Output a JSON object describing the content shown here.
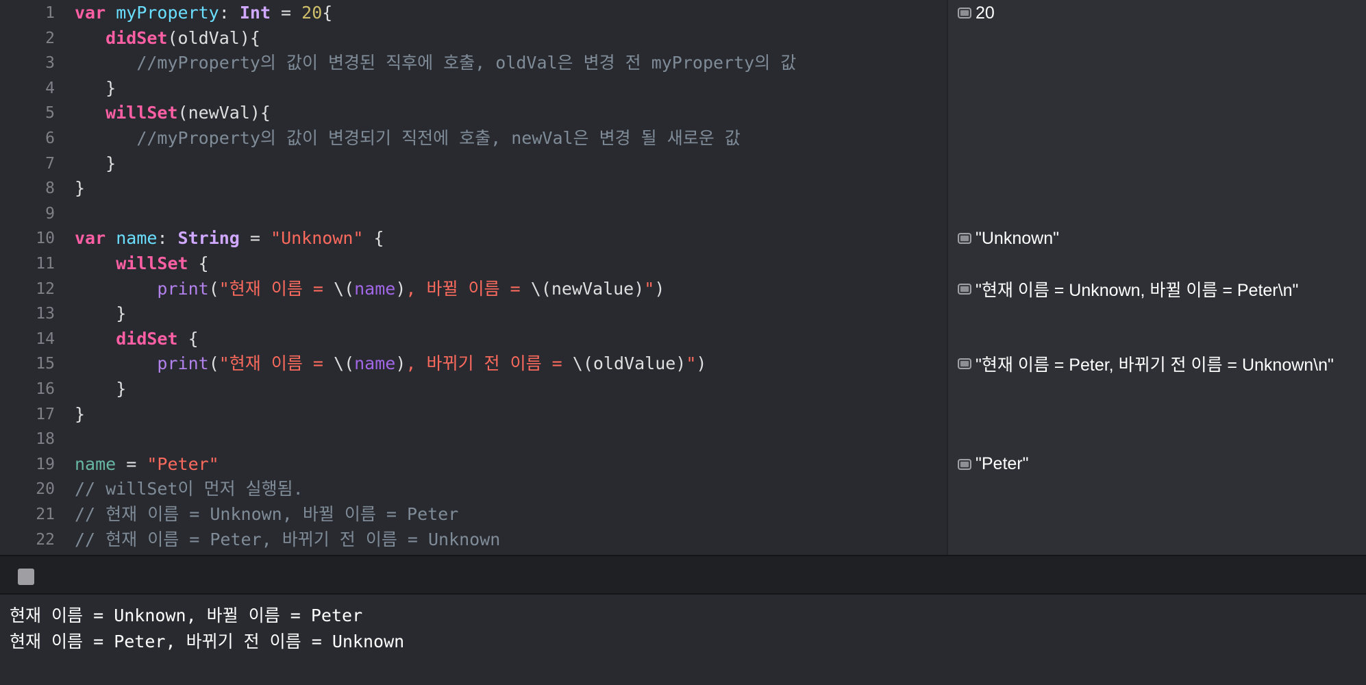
{
  "editor": {
    "lines": [
      {
        "n": "1",
        "tokens": [
          {
            "t": "var",
            "k": "keyword"
          },
          {
            "t": " ",
            "k": "plain"
          },
          {
            "t": "myProperty",
            "k": "prop"
          },
          {
            "t": ": ",
            "k": "plain"
          },
          {
            "t": "Int",
            "k": "type"
          },
          {
            "t": " = ",
            "k": "plain"
          },
          {
            "t": "20",
            "k": "number"
          },
          {
            "t": "{",
            "k": "plain"
          }
        ]
      },
      {
        "n": "2",
        "tokens": [
          {
            "t": "   ",
            "k": "plain"
          },
          {
            "t": "didSet",
            "k": "keyword"
          },
          {
            "t": "(oldVal){",
            "k": "plain"
          }
        ]
      },
      {
        "n": "3",
        "tokens": [
          {
            "t": "      ",
            "k": "plain"
          },
          {
            "t": "//myProperty의 값이 변경된 직후에 호출, oldVal은 변경 전 myProperty의 값",
            "k": "comment"
          }
        ]
      },
      {
        "n": "4",
        "tokens": [
          {
            "t": "   }",
            "k": "plain"
          }
        ]
      },
      {
        "n": "5",
        "tokens": [
          {
            "t": "   ",
            "k": "plain"
          },
          {
            "t": "willSet",
            "k": "keyword"
          },
          {
            "t": "(newVal){",
            "k": "plain"
          }
        ]
      },
      {
        "n": "6",
        "tokens": [
          {
            "t": "      ",
            "k": "plain"
          },
          {
            "t": "//myProperty의 값이 변경되기 직전에 호출, newVal은 변경 될 새로운 값",
            "k": "comment"
          }
        ]
      },
      {
        "n": "7",
        "tokens": [
          {
            "t": "   }",
            "k": "plain"
          }
        ]
      },
      {
        "n": "8",
        "tokens": [
          {
            "t": "}",
            "k": "plain"
          }
        ]
      },
      {
        "n": "9",
        "tokens": []
      },
      {
        "n": "10",
        "tokens": [
          {
            "t": "var",
            "k": "keyword"
          },
          {
            "t": " ",
            "k": "plain"
          },
          {
            "t": "name",
            "k": "prop"
          },
          {
            "t": ": ",
            "k": "plain"
          },
          {
            "t": "String",
            "k": "type"
          },
          {
            "t": " = ",
            "k": "plain"
          },
          {
            "t": "\"Unknown\"",
            "k": "string"
          },
          {
            "t": " {",
            "k": "plain"
          }
        ]
      },
      {
        "n": "11",
        "tokens": [
          {
            "t": "    ",
            "k": "plain"
          },
          {
            "t": "willSet",
            "k": "keyword"
          },
          {
            "t": " {",
            "k": "plain"
          }
        ]
      },
      {
        "n": "12",
        "tokens": [
          {
            "t": "        ",
            "k": "plain"
          },
          {
            "t": "print",
            "k": "fn"
          },
          {
            "t": "(",
            "k": "plain"
          },
          {
            "t": "\"현재 이름 = ",
            "k": "string"
          },
          {
            "t": "\\(",
            "k": "plain"
          },
          {
            "t": "name",
            "k": "var"
          },
          {
            "t": ")",
            "k": "plain"
          },
          {
            "t": ", 바뀔 이름 = ",
            "k": "string"
          },
          {
            "t": "\\(newValue)",
            "k": "plain"
          },
          {
            "t": "\"",
            "k": "string"
          },
          {
            "t": ")",
            "k": "plain"
          }
        ]
      },
      {
        "n": "13",
        "tokens": [
          {
            "t": "    }",
            "k": "plain"
          }
        ]
      },
      {
        "n": "14",
        "tokens": [
          {
            "t": "    ",
            "k": "plain"
          },
          {
            "t": "didSet",
            "k": "keyword"
          },
          {
            "t": " {",
            "k": "plain"
          }
        ]
      },
      {
        "n": "15",
        "tokens": [
          {
            "t": "        ",
            "k": "plain"
          },
          {
            "t": "print",
            "k": "fn"
          },
          {
            "t": "(",
            "k": "plain"
          },
          {
            "t": "\"현재 이름 = ",
            "k": "string"
          },
          {
            "t": "\\(",
            "k": "plain"
          },
          {
            "t": "name",
            "k": "var"
          },
          {
            "t": ")",
            "k": "plain"
          },
          {
            "t": ", 바뀌기 전 이름 = ",
            "k": "string"
          },
          {
            "t": "\\(oldValue)",
            "k": "plain"
          },
          {
            "t": "\"",
            "k": "string"
          },
          {
            "t": ")",
            "k": "plain"
          }
        ]
      },
      {
        "n": "16",
        "tokens": [
          {
            "t": "    }",
            "k": "plain"
          }
        ]
      },
      {
        "n": "17",
        "tokens": [
          {
            "t": "}",
            "k": "plain"
          }
        ]
      },
      {
        "n": "18",
        "tokens": []
      },
      {
        "n": "19",
        "tokens": [
          {
            "t": "name",
            "k": "teal"
          },
          {
            "t": " = ",
            "k": "plain"
          },
          {
            "t": "\"Peter\"",
            "k": "string"
          }
        ]
      },
      {
        "n": "20",
        "tokens": [
          {
            "t": "// willSet이 먼저 실행됨.",
            "k": "comment"
          }
        ]
      },
      {
        "n": "21",
        "tokens": [
          {
            "t": "// 현재 이름 = Unknown, 바뀔 이름 = Peter",
            "k": "comment"
          }
        ]
      },
      {
        "n": "22",
        "tokens": [
          {
            "t": "// 현재 이름 = Peter, 바뀌기 전 이름 = Unknown",
            "k": "comment"
          }
        ]
      }
    ]
  },
  "results": [
    {
      "line": 1,
      "text": "20"
    },
    {
      "line": 10,
      "text": "\"Unknown\""
    },
    {
      "line": 12,
      "text": "\"현재 이름 = Unknown, 바뀔 이름 = Peter\\n\""
    },
    {
      "line": 15,
      "text": "\"현재 이름 = Peter, 바뀌기 전 이름 = Unknown\\n\""
    },
    {
      "line": 19,
      "text": "\"Peter\""
    }
  ],
  "console": {
    "lines": [
      "현재 이름 = Unknown, 바뀔 이름 = Peter",
      "현재 이름 = Peter, 바뀌기 전 이름 = Unknown"
    ]
  },
  "colors": {
    "background": "#292a30",
    "sidebar": "#2f3036",
    "keyword": "#fc5fa3",
    "string": "#fc6a5d",
    "number": "#d0bf69",
    "comment": "#7f8c98",
    "type": "#d0a8ff"
  }
}
